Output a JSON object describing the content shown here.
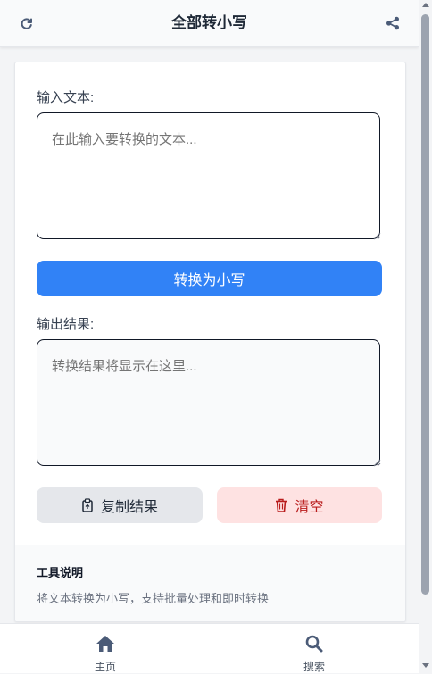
{
  "header": {
    "title": "全部转小写",
    "refresh_icon": "refresh-icon",
    "share_icon": "share-icon"
  },
  "input": {
    "label": "输入文本:",
    "placeholder": "在此输入要转换的文本...",
    "value": ""
  },
  "convert_button": {
    "label": "转换为小写"
  },
  "output": {
    "label": "输出结果:",
    "placeholder": "转换结果将显示在这里...",
    "value": ""
  },
  "actions": {
    "copy_label": "复制结果",
    "copy_icon": "clipboard-icon",
    "clear_label": "清空",
    "clear_icon": "trash-icon"
  },
  "info": {
    "title": "工具说明",
    "description": "将文本转换为小写，支持批量处理和即时转换"
  },
  "bottom_nav": {
    "items": [
      {
        "label": "主页",
        "icon": "home-icon"
      },
      {
        "label": "搜索",
        "icon": "search-icon"
      }
    ]
  },
  "colors": {
    "primary": "#3182f6",
    "danger_bg": "#fee2e2",
    "danger_text": "#b91c1c",
    "neutral_bg": "#e5e7eb",
    "icon": "#4b5b77"
  }
}
